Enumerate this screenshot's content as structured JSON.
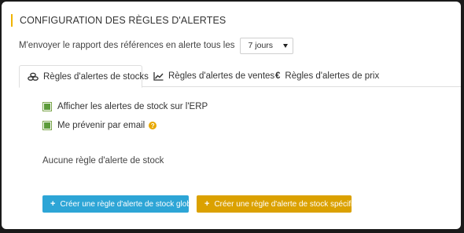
{
  "section": {
    "title": "CONFIGURATION DES RÈGLES D'ALERTES"
  },
  "report": {
    "label": "M'envoyer le rapport des références en alerte tous les",
    "selected": "7 jours"
  },
  "tabs": [
    {
      "label": "Règles d'alertes de stocks",
      "icon": "coins-icon",
      "active": true
    },
    {
      "label": "Règles d'alertes de ventes",
      "icon": "line-chart-icon",
      "active": false
    },
    {
      "label": "Règles d'alertes de prix",
      "icon": "euro-icon",
      "active": false
    }
  ],
  "stock_tab": {
    "checkbox_erp": {
      "label": "Afficher les alertes de stock sur l'ERP",
      "checked": true
    },
    "checkbox_email": {
      "label": "Me prévenir par email",
      "checked": true
    },
    "empty_text": "Aucune règle d'alerte de stock",
    "buttons": {
      "global": "Créer une règle d'alerte de stock globale",
      "specific": "Créer une règle d'alerte de stock spécifique"
    }
  },
  "colors": {
    "accent_bar": "#f0b400",
    "checkbox_green": "#5c9b3a",
    "help_icon": "#e8a800",
    "button_global": "#2da5d6",
    "button_specific": "#dba100"
  }
}
